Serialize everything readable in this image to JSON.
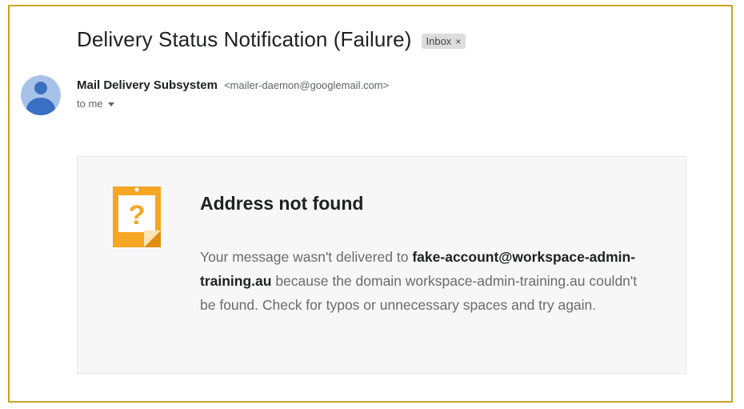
{
  "email": {
    "subject": "Delivery Status Notification (Failure)",
    "label": "Inbox",
    "label_close": "×",
    "sender_name": "Mail Delivery Subsystem",
    "sender_email": "<mailer-daemon@googlemail.com>",
    "recipient": "to me"
  },
  "bounce_card": {
    "icon": "question-note-icon",
    "title": "Address not found",
    "message_prefix": "Your message wasn't delivered to ",
    "failed_address": "fake-account@workspace-admin-training.au",
    "message_suffix": " because the domain workspace-admin-training.au couldn't be found. Check for typos or unnecessary spaces and try again."
  },
  "colors": {
    "frame": "#c9a227",
    "icon_orange": "#f5a623",
    "avatar_bg": "#a7c2e8",
    "avatar_fg": "#3a6fc4"
  }
}
